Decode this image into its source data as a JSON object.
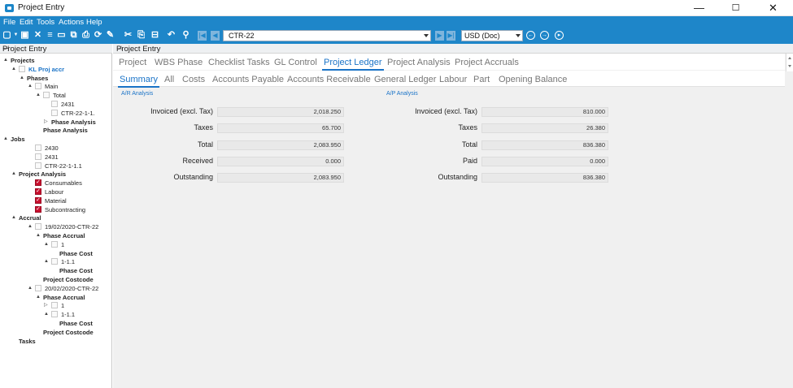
{
  "window": {
    "title": "Project Entry",
    "minimize": "—",
    "maximize": "☐",
    "close": "✕"
  },
  "menu": [
    "File",
    "Edit",
    "Tools",
    "Actions",
    "Help"
  ],
  "toolbar": {
    "code_value": "CTR-22",
    "currency_value": "USD (Doc)"
  },
  "left_panel": {
    "title": "Project Entry",
    "tree": [
      {
        "label": "Projects",
        "style": "bold",
        "depth": 0,
        "arrow": "▲",
        "icon": "none"
      },
      {
        "label": "KL Proj accr",
        "style": "blue",
        "depth": 1,
        "arrow": "▲",
        "icon": "box"
      },
      {
        "label": "Phases",
        "style": "bold",
        "depth": 2,
        "arrow": "▲",
        "icon": "none"
      },
      {
        "label": "Main",
        "style": "normal",
        "depth": 3,
        "arrow": "▲",
        "icon": "box"
      },
      {
        "label": "Total",
        "style": "normal",
        "depth": 4,
        "arrow": "▲",
        "icon": "box"
      },
      {
        "label": "2431",
        "style": "normal",
        "depth": 5,
        "arrow": "",
        "icon": "box"
      },
      {
        "label": "CTR-22-1-1.",
        "style": "normal",
        "depth": 5,
        "arrow": "",
        "icon": "box"
      },
      {
        "label": "Phase Analysis",
        "style": "bold",
        "depth": 5,
        "arrow": "▷",
        "icon": "none"
      },
      {
        "label": "Phase Analysis",
        "style": "bold",
        "depth": 4,
        "arrow": "",
        "icon": "none"
      },
      {
        "label": "Jobs",
        "style": "bold",
        "depth": 0,
        "arrow": "▲",
        "icon": "none"
      },
      {
        "label": "2430",
        "style": "normal",
        "depth": 3,
        "arrow": "",
        "icon": "box"
      },
      {
        "label": "2431",
        "style": "normal",
        "depth": 3,
        "arrow": "",
        "icon": "box"
      },
      {
        "label": "CTR-22-1-1.1",
        "style": "normal",
        "depth": 3,
        "arrow": "",
        "icon": "box"
      },
      {
        "label": "Project Analysis",
        "style": "bold",
        "depth": 1,
        "arrow": "▲",
        "icon": "none"
      },
      {
        "label": "Consumables",
        "style": "normal",
        "depth": 3,
        "arrow": "",
        "icon": "check"
      },
      {
        "label": "Labour",
        "style": "normal",
        "depth": 3,
        "arrow": "",
        "icon": "check"
      },
      {
        "label": "Material",
        "style": "normal",
        "depth": 3,
        "arrow": "",
        "icon": "check"
      },
      {
        "label": "Subcontracting",
        "style": "normal",
        "depth": 3,
        "arrow": "",
        "icon": "check"
      },
      {
        "label": "Accrual",
        "style": "bold",
        "depth": 1,
        "arrow": "▲",
        "icon": "none"
      },
      {
        "label": "19/02/2020-CTR-22",
        "style": "normal",
        "depth": 3,
        "arrow": "▲",
        "icon": "box"
      },
      {
        "label": "Phase Accrual",
        "style": "bold",
        "depth": 4,
        "arrow": "▲",
        "icon": "none"
      },
      {
        "label": "1",
        "style": "normal",
        "depth": 5,
        "arrow": "▲",
        "icon": "box"
      },
      {
        "label": "Phase Cost",
        "style": "bold",
        "depth": 6,
        "arrow": "",
        "icon": "none"
      },
      {
        "label": "1-1.1",
        "style": "normal",
        "depth": 5,
        "arrow": "▲",
        "icon": "box"
      },
      {
        "label": "Phase Cost",
        "style": "bold",
        "depth": 6,
        "arrow": "",
        "icon": "none"
      },
      {
        "label": "Project Costcode",
        "style": "bold",
        "depth": 4,
        "arrow": "",
        "icon": "none"
      },
      {
        "label": "20/02/2020-CTR-22",
        "style": "normal",
        "depth": 3,
        "arrow": "▲",
        "icon": "box"
      },
      {
        "label": "Phase Accrual",
        "style": "bold",
        "depth": 4,
        "arrow": "▲",
        "icon": "none"
      },
      {
        "label": "1",
        "style": "normal",
        "depth": 5,
        "arrow": "▷",
        "icon": "box"
      },
      {
        "label": "1-1.1",
        "style": "normal",
        "depth": 5,
        "arrow": "▲",
        "icon": "box"
      },
      {
        "label": "Phase Cost",
        "style": "bold",
        "depth": 6,
        "arrow": "",
        "icon": "none"
      },
      {
        "label": "Project Costcode",
        "style": "bold",
        "depth": 4,
        "arrow": "",
        "icon": "none"
      },
      {
        "label": "Tasks",
        "style": "bold",
        "depth": 1,
        "arrow": "",
        "icon": "none"
      }
    ]
  },
  "right_panel": {
    "title": "Project Entry",
    "main_tabs": [
      "Project",
      "WBS Phase",
      "Checklist Tasks",
      "GL Control",
      "Project Ledger",
      "Project Analysis",
      "Project Accruals"
    ],
    "sub_tabs": [
      "Summary",
      "All",
      "Costs",
      "Accounts Payable",
      "Accounts Receivable",
      "General Ledger",
      "Labour",
      "Part",
      "Opening Balance"
    ],
    "ar": {
      "title": "A/R Analysis",
      "fields": [
        {
          "label": "Invoiced (excl. Tax)",
          "value": "2,018.250"
        },
        {
          "label": "Taxes",
          "value": "65.700"
        },
        {
          "label": "Total",
          "value": "2,083.950"
        },
        {
          "label": "Received",
          "value": "0.000"
        },
        {
          "label": "Outstanding",
          "value": "2,083.950"
        }
      ]
    },
    "ap": {
      "title": "A/P Analysis",
      "fields": [
        {
          "label": "Invoiced (excl. Tax)",
          "value": "810.000"
        },
        {
          "label": "Taxes",
          "value": "26.380"
        },
        {
          "label": "Total",
          "value": "836.380"
        },
        {
          "label": "Paid",
          "value": "0.000"
        },
        {
          "label": "Outstanding",
          "value": "836.380"
        }
      ]
    }
  },
  "colors": {
    "accent": "#1e86c9",
    "active_tab": "#1a73c7",
    "check": "#c8102e"
  }
}
